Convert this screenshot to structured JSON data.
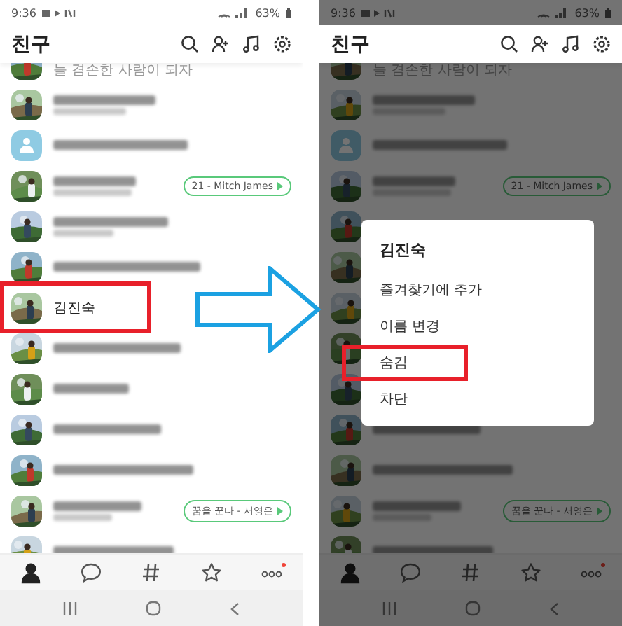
{
  "screens": [
    {
      "status_bar": {
        "time": "9:36",
        "battery": "63%"
      },
      "header": {
        "title": "친구"
      },
      "rows": [
        {
          "kind": "partial",
          "photo": true,
          "status": "늘 겸손한 사람이 되자",
          "status_redacted": false,
          "highlighted": false
        },
        {
          "kind": "redacted",
          "photo": true,
          "status_redacted": true,
          "highlighted": false
        },
        {
          "kind": "redacted",
          "photo": false,
          "status_redacted": false,
          "highlighted": false
        },
        {
          "kind": "redacted",
          "photo": true,
          "status_redacted": true,
          "badge": "21 - Mitch James",
          "highlighted": false
        },
        {
          "kind": "redacted",
          "photo": true,
          "status_redacted": true,
          "highlighted": false
        },
        {
          "kind": "redacted",
          "photo": true,
          "status_redacted": false,
          "highlighted": false
        },
        {
          "kind": "named",
          "name": "김진숙",
          "photo": true,
          "status_redacted": false,
          "highlighted": true
        },
        {
          "kind": "redacted",
          "photo": true,
          "status_redacted": false,
          "highlighted": false
        },
        {
          "kind": "redacted",
          "photo": true,
          "status_redacted": false,
          "highlighted": false
        },
        {
          "kind": "redacted",
          "photo": true,
          "status_redacted": false,
          "highlighted": false
        },
        {
          "kind": "redacted",
          "photo": true,
          "status_redacted": false,
          "highlighted": false
        },
        {
          "kind": "redacted",
          "photo": true,
          "status_redacted": true,
          "badge": "꿈을 꾼다 - 서영은",
          "highlighted": false
        },
        {
          "kind": "redacted",
          "photo": true,
          "status_redacted": false,
          "highlighted": false
        }
      ],
      "bottom_tabs": [
        {
          "selected": true,
          "new": false
        },
        {
          "selected": false,
          "new": false
        },
        {
          "selected": false,
          "new": false
        },
        {
          "selected": false,
          "new": false
        },
        {
          "selected": false,
          "new": true
        }
      ]
    },
    {
      "status_bar": {
        "time": "9:36",
        "battery": "63%"
      },
      "header": {
        "title": "친구"
      },
      "rows": [
        {
          "kind": "partial",
          "photo": true,
          "status": "늘 겸손한 사람이 되자",
          "status_redacted": false,
          "highlighted": false
        },
        {
          "kind": "redacted",
          "photo": true,
          "status_redacted": true,
          "highlighted": false
        },
        {
          "kind": "redacted",
          "photo": false,
          "status_redacted": false,
          "highlighted": false
        },
        {
          "kind": "redacted",
          "photo": true,
          "status_redacted": true,
          "badge": "21 - Mitch James",
          "highlighted": false
        },
        {
          "kind": "covered",
          "photo": true,
          "highlighted": false
        },
        {
          "kind": "covered",
          "photo": true,
          "highlighted": false
        },
        {
          "kind": "covered",
          "photo": true,
          "highlighted": false
        },
        {
          "kind": "covered",
          "photo": true,
          "highlighted": false
        },
        {
          "kind": "covered",
          "photo": true,
          "highlighted": false
        },
        {
          "kind": "redacted",
          "photo": true,
          "status_redacted": false,
          "highlighted": false
        },
        {
          "kind": "redacted",
          "photo": true,
          "status_redacted": false,
          "highlighted": false
        },
        {
          "kind": "redacted",
          "photo": true,
          "status_redacted": true,
          "badge": "꿈을 꾼다 - 서영은",
          "highlighted": false
        },
        {
          "kind": "redacted",
          "photo": true,
          "status_redacted": false,
          "highlighted": false
        }
      ],
      "bottom_tabs": [
        {
          "selected": true,
          "new": false
        },
        {
          "selected": false,
          "new": false
        },
        {
          "selected": false,
          "new": false
        },
        {
          "selected": false,
          "new": false
        },
        {
          "selected": false,
          "new": true
        }
      ],
      "dialog": {
        "title": "김진숙",
        "items": [
          {
            "label": "즐겨찾기에 추가",
            "highlighted": false
          },
          {
            "label": "이름 변경",
            "highlighted": false
          },
          {
            "label": "숨김",
            "highlighted": true
          },
          {
            "label": "차단",
            "highlighted": false
          }
        ]
      }
    }
  ]
}
